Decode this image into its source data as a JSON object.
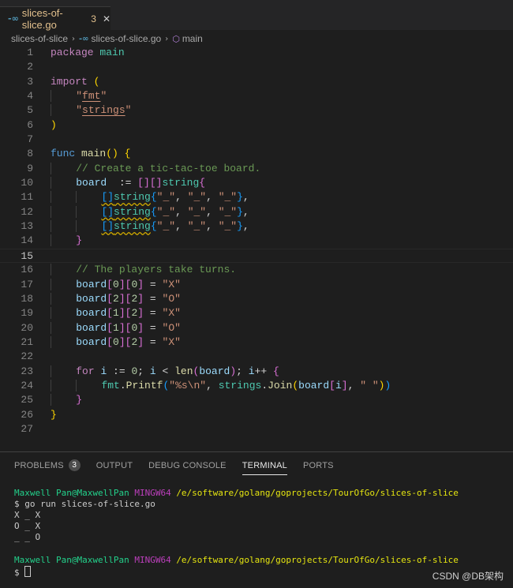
{
  "tab": {
    "icon": "go-file-icon",
    "filename": "slices-of-slice.go",
    "problem_count": "3",
    "close": "✕"
  },
  "breadcrumb": {
    "folder": "slices-of-slice",
    "file": "slices-of-slice.go",
    "symbol": "main"
  },
  "editor": {
    "current_line": 15,
    "lines": [
      [
        [
          "kw",
          "package "
        ],
        [
          "pkg",
          "main"
        ]
      ],
      [],
      [
        [
          "kw",
          "import "
        ],
        [
          "br1",
          "("
        ]
      ],
      [
        [
          "ind",
          "    "
        ],
        [
          "str",
          "\""
        ],
        [
          "str ul",
          "fmt"
        ],
        [
          "str",
          "\""
        ]
      ],
      [
        [
          "ind",
          "    "
        ],
        [
          "str",
          "\""
        ],
        [
          "str ul",
          "strings"
        ],
        [
          "str",
          "\""
        ]
      ],
      [
        [
          "br1",
          ")"
        ]
      ],
      [],
      [
        [
          "kwb",
          "func "
        ],
        [
          "fn",
          "main"
        ],
        [
          "br1",
          "() {"
        ]
      ],
      [
        [
          "ind",
          "    "
        ],
        [
          "cm",
          "// Create a tic-tac-toe board."
        ]
      ],
      [
        [
          "ind",
          "    "
        ],
        [
          "var",
          "board"
        ],
        [
          "",
          "  := "
        ],
        [
          "br2",
          "[]"
        ],
        [
          "br2",
          "[]"
        ],
        [
          "ty",
          "string"
        ],
        [
          "br2",
          "{"
        ]
      ],
      [
        [
          "ind",
          "    "
        ],
        [
          "ind",
          "    "
        ],
        [
          "br3 wavy",
          "[]"
        ],
        [
          "ty wavy",
          "string"
        ],
        [
          "br3",
          "{"
        ],
        [
          "str",
          "\"_\""
        ],
        [
          "",
          ", "
        ],
        [
          "str",
          "\"_\""
        ],
        [
          "",
          ", "
        ],
        [
          "str",
          "\"_\""
        ],
        [
          "br3",
          "}"
        ],
        [
          "",
          ","
        ]
      ],
      [
        [
          "ind",
          "    "
        ],
        [
          "ind",
          "    "
        ],
        [
          "br3 wavy",
          "[]"
        ],
        [
          "ty wavy",
          "string"
        ],
        [
          "br3",
          "{"
        ],
        [
          "str",
          "\"_\""
        ],
        [
          "",
          ", "
        ],
        [
          "str",
          "\"_\""
        ],
        [
          "",
          ", "
        ],
        [
          "str",
          "\"_\""
        ],
        [
          "br3",
          "}"
        ],
        [
          "",
          ","
        ]
      ],
      [
        [
          "ind",
          "    "
        ],
        [
          "ind",
          "    "
        ],
        [
          "br3 wavy",
          "[]"
        ],
        [
          "ty wavy",
          "string"
        ],
        [
          "br3",
          "{"
        ],
        [
          "str",
          "\"_\""
        ],
        [
          "",
          ", "
        ],
        [
          "str",
          "\"_\""
        ],
        [
          "",
          ", "
        ],
        [
          "str",
          "\"_\""
        ],
        [
          "br3",
          "}"
        ],
        [
          "",
          ","
        ]
      ],
      [
        [
          "ind",
          "    "
        ],
        [
          "br2",
          "}"
        ]
      ],
      [],
      [
        [
          "ind",
          "    "
        ],
        [
          "cm",
          "// The players take turns."
        ]
      ],
      [
        [
          "ind",
          "    "
        ],
        [
          "var",
          "board"
        ],
        [
          "br2",
          "["
        ],
        [
          "num",
          "0"
        ],
        [
          "br2",
          "]"
        ],
        [
          "br2",
          "["
        ],
        [
          "num",
          "0"
        ],
        [
          "br2",
          "]"
        ],
        [
          "",
          " = "
        ],
        [
          "str",
          "\"X\""
        ]
      ],
      [
        [
          "ind",
          "    "
        ],
        [
          "var",
          "board"
        ],
        [
          "br2",
          "["
        ],
        [
          "num",
          "2"
        ],
        [
          "br2",
          "]"
        ],
        [
          "br2",
          "["
        ],
        [
          "num",
          "2"
        ],
        [
          "br2",
          "]"
        ],
        [
          "",
          " = "
        ],
        [
          "str",
          "\"O\""
        ]
      ],
      [
        [
          "ind",
          "    "
        ],
        [
          "var",
          "board"
        ],
        [
          "br2",
          "["
        ],
        [
          "num",
          "1"
        ],
        [
          "br2",
          "]"
        ],
        [
          "br2",
          "["
        ],
        [
          "num",
          "2"
        ],
        [
          "br2",
          "]"
        ],
        [
          "",
          " = "
        ],
        [
          "str",
          "\"X\""
        ]
      ],
      [
        [
          "ind",
          "    "
        ],
        [
          "var",
          "board"
        ],
        [
          "br2",
          "["
        ],
        [
          "num",
          "1"
        ],
        [
          "br2",
          "]"
        ],
        [
          "br2",
          "["
        ],
        [
          "num",
          "0"
        ],
        [
          "br2",
          "]"
        ],
        [
          "",
          " = "
        ],
        [
          "str",
          "\"O\""
        ]
      ],
      [
        [
          "ind",
          "    "
        ],
        [
          "var",
          "board"
        ],
        [
          "br2",
          "["
        ],
        [
          "num",
          "0"
        ],
        [
          "br2",
          "]"
        ],
        [
          "br2",
          "["
        ],
        [
          "num",
          "2"
        ],
        [
          "br2",
          "]"
        ],
        [
          "",
          " = "
        ],
        [
          "str",
          "\"X\""
        ]
      ],
      [],
      [
        [
          "ind",
          "    "
        ],
        [
          "kw",
          "for "
        ],
        [
          "var",
          "i"
        ],
        [
          "",
          " := "
        ],
        [
          "num",
          "0"
        ],
        [
          "",
          "; "
        ],
        [
          "var",
          "i"
        ],
        [
          "",
          " < "
        ],
        [
          "fn",
          "len"
        ],
        [
          "br2",
          "("
        ],
        [
          "var",
          "board"
        ],
        [
          "br2",
          ")"
        ],
        [
          "",
          "; "
        ],
        [
          "var",
          "i"
        ],
        [
          "",
          "++ "
        ],
        [
          "br2",
          "{"
        ]
      ],
      [
        [
          "ind",
          "    "
        ],
        [
          "ind",
          "    "
        ],
        [
          "pkg",
          "fmt"
        ],
        [
          "",
          "."
        ],
        [
          "fn",
          "Printf"
        ],
        [
          "br3",
          "("
        ],
        [
          "str",
          "\"%s\\n\""
        ],
        [
          "",
          ", "
        ],
        [
          "pkg",
          "strings"
        ],
        [
          "",
          "."
        ],
        [
          "fn",
          "Join"
        ],
        [
          "br1",
          "("
        ],
        [
          "var",
          "board"
        ],
        [
          "br2",
          "["
        ],
        [
          "var",
          "i"
        ],
        [
          "br2",
          "]"
        ],
        [
          "",
          ", "
        ],
        [
          "str",
          "\" \""
        ],
        [
          "br1",
          ")"
        ],
        [
          "br3",
          ")"
        ]
      ],
      [
        [
          "ind",
          "    "
        ],
        [
          "br2",
          "}"
        ]
      ],
      [
        [
          "br1",
          "}"
        ]
      ],
      []
    ]
  },
  "panel": {
    "tabs": [
      {
        "label": "PROBLEMS",
        "badge": "3"
      },
      {
        "label": "OUTPUT"
      },
      {
        "label": "DEBUG CONSOLE"
      },
      {
        "label": "TERMINAL"
      },
      {
        "label": "PORTS"
      }
    ],
    "active_tab": "TERMINAL",
    "terminal": {
      "user_host": "Maxwell Pan@MaxwellPan",
      "env": "MINGW64",
      "path": "/e/software/golang/goprojects/TourOfGo/slices-of-slice",
      "prompt": "$",
      "command": "go run slices-of-slice.go",
      "output": [
        "X _ X",
        "O _ X",
        "_ _ O"
      ]
    }
  },
  "watermark": "CSDN @DB架构"
}
